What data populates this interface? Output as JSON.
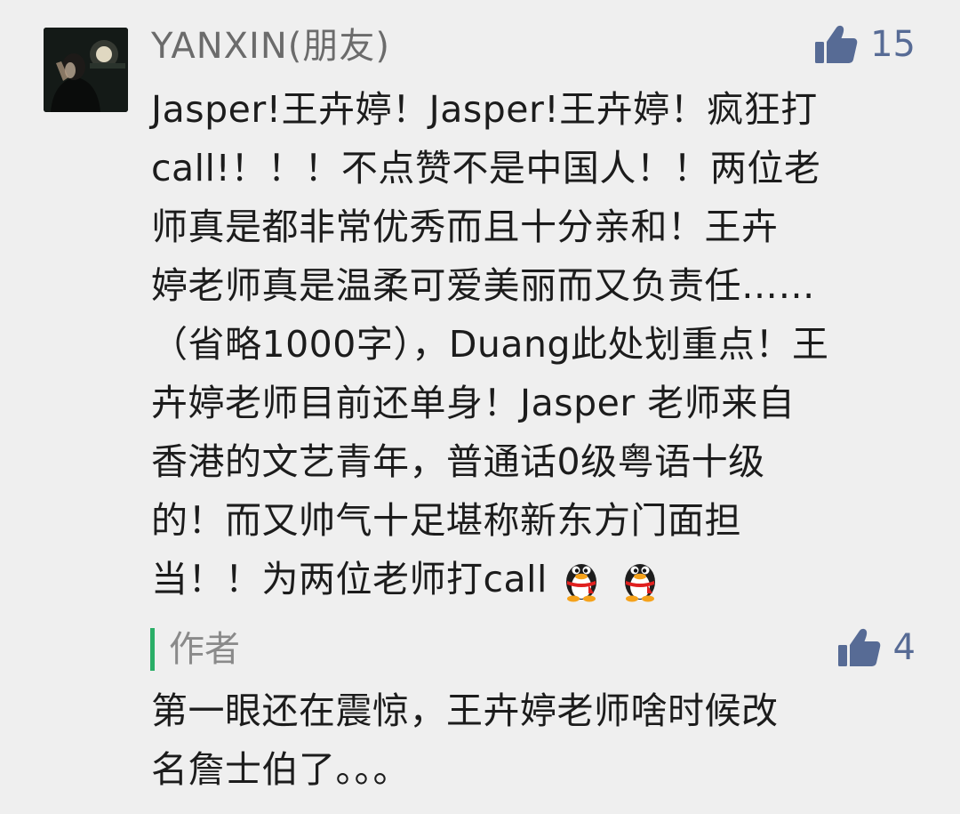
{
  "comment": {
    "username": "YANXIN(朋友)",
    "likes": "15",
    "avatar_icon": "user-avatar-photo",
    "like_icon": "thumbs-up-icon",
    "lines": [
      "Jasper!王卉婷！Jasper!王卉婷！疯狂打",
      "call!！！！不点赞不是中国人！！两位老",
      "师真是都非常优秀而且十分亲和！王卉",
      "婷老师真是温柔可爱美丽而又负责任……",
      "（省略1000字），Duang此处划重点！王",
      "卉婷老师目前还单身！Jasper 老师来自",
      "香港的文艺青年，普通话0级粤语十级",
      "的！而又帅气十足堪称新东方门面担",
      "当！！为两位老师打call"
    ],
    "emoji_icon": "qq-penguin-emoji"
  },
  "reply": {
    "author_label": "作者",
    "likes": "4",
    "lines": [
      "第一眼还在震惊，王卉婷老师啥时候改",
      "名詹士伯了。。。"
    ]
  },
  "colors": {
    "background": "#efefef",
    "link_blue": "#576b95",
    "author_bar_green": "#2aae67",
    "text": "#1c1c1c",
    "muted": "#6b6b6b"
  }
}
